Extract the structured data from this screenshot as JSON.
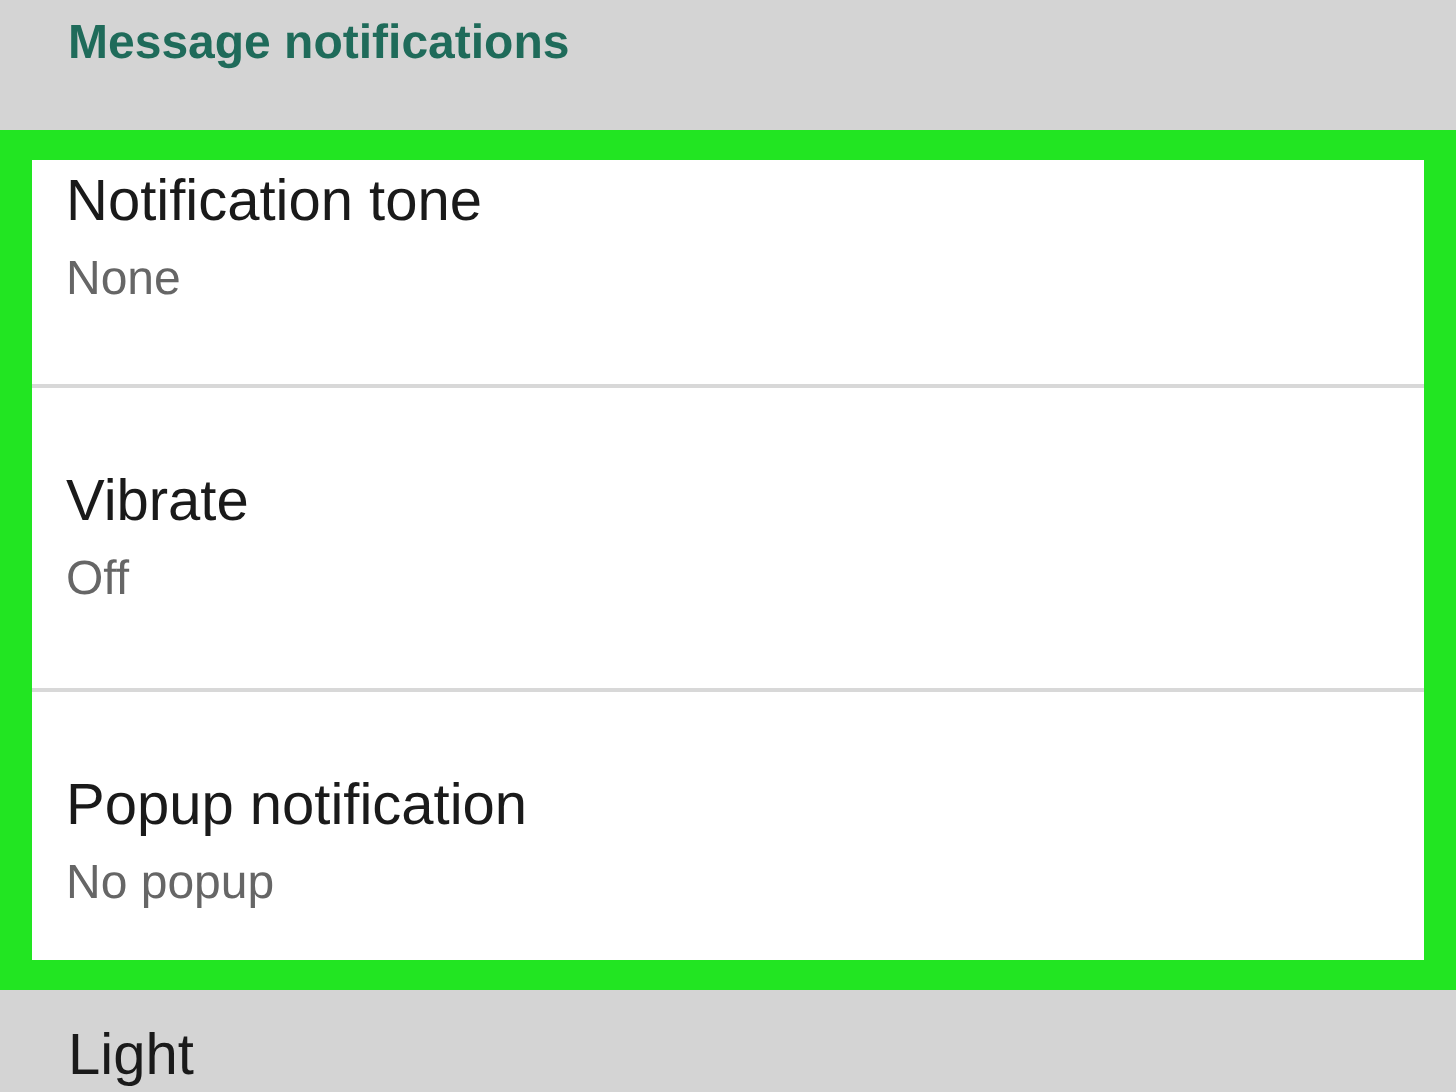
{
  "section": {
    "title": "Message notifications"
  },
  "items": [
    {
      "title": "Notification tone",
      "value": "None"
    },
    {
      "title": "Vibrate",
      "value": "Off"
    },
    {
      "title": "Popup notification",
      "value": "No popup"
    }
  ],
  "next_item": {
    "title": "Light"
  }
}
